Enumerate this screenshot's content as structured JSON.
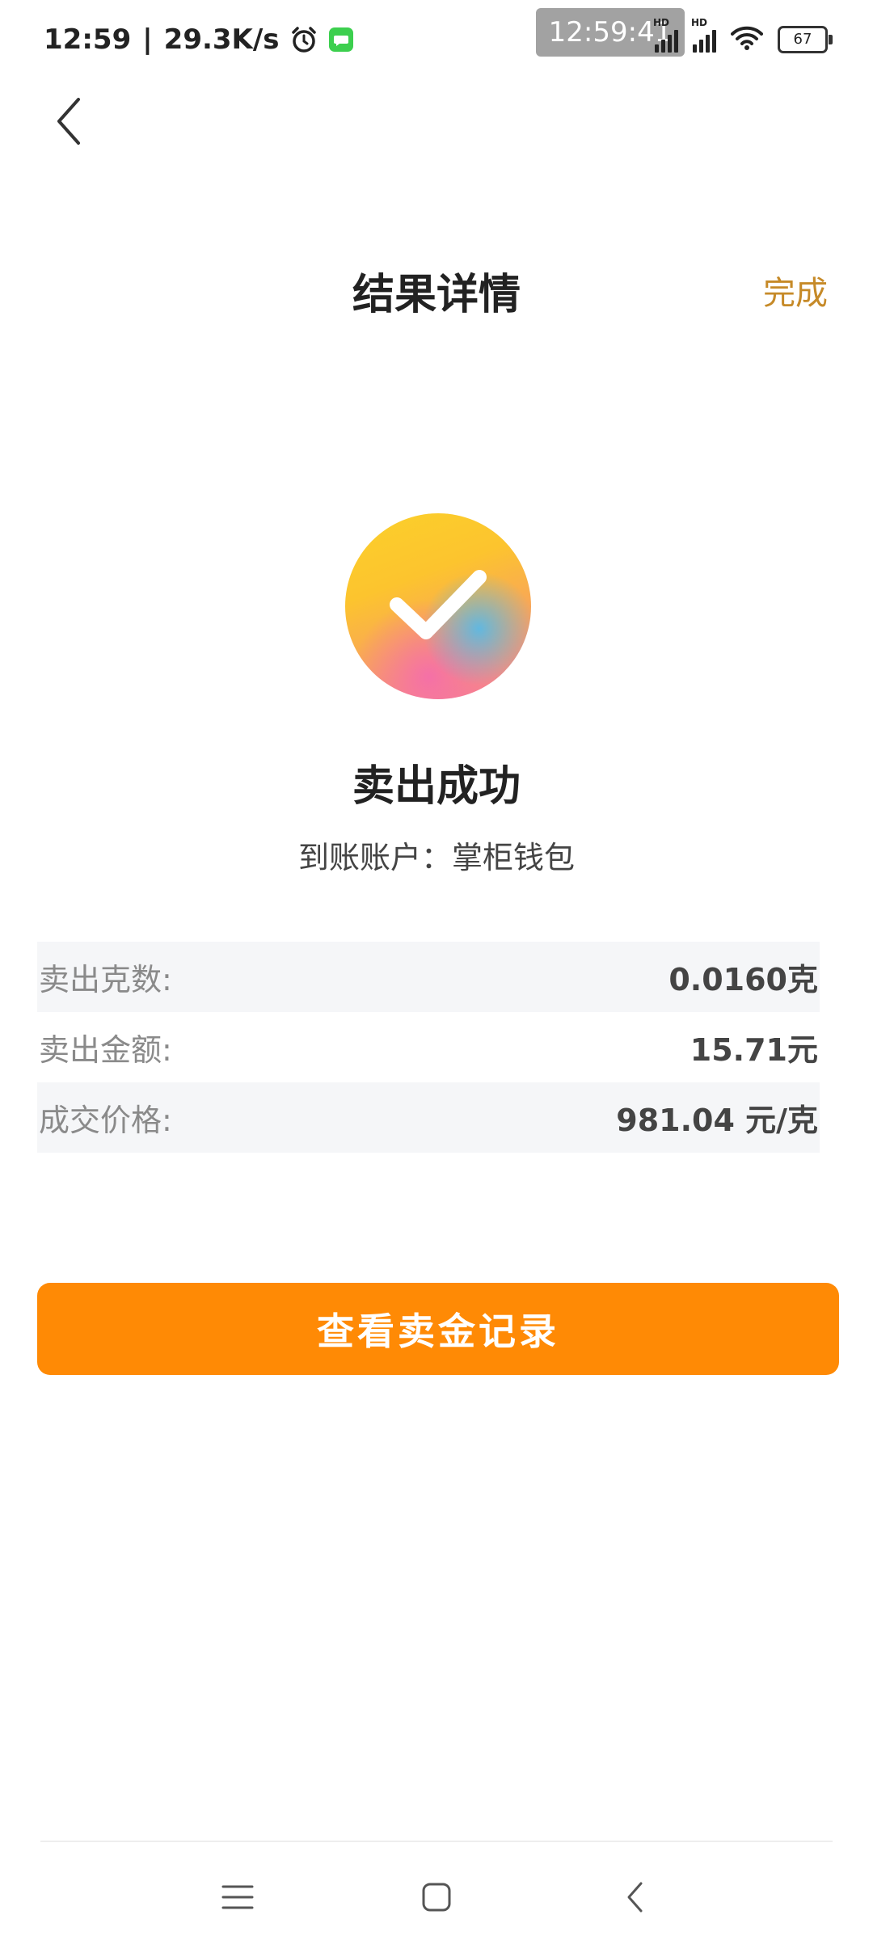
{
  "status_bar": {
    "time": "12:59",
    "separator": "|",
    "net_speed": "29.3K/s",
    "time_overlay": "12:59:41",
    "signal_tag_1": "HD",
    "signal_tag_2": "HD",
    "battery": "67",
    "icons": [
      "alarm-icon",
      "message-icon",
      "signal-icon",
      "signal-icon",
      "wifi-icon",
      "battery-icon"
    ]
  },
  "header": {
    "title": "结果详情",
    "done_label": "完成",
    "back_icon": "chevron-left-icon"
  },
  "result": {
    "title": "卖出成功",
    "account_line": "到账账户：掌柜钱包",
    "icon": "check-icon"
  },
  "details": [
    {
      "label": "卖出克数:",
      "value": "0.0160克"
    },
    {
      "label": "卖出金额:",
      "value": "15.71元"
    },
    {
      "label": "成交价格:",
      "value": "981.04 元/克"
    }
  ],
  "primary_button": {
    "label": "查看卖金记录"
  },
  "nav_bar": {
    "icons": [
      "menu-icon",
      "home-icon",
      "back-icon"
    ]
  },
  "colors": {
    "accent": "#ff8a05",
    "done_text": "#c68a28",
    "row_shade": "#f5f6f8"
  }
}
